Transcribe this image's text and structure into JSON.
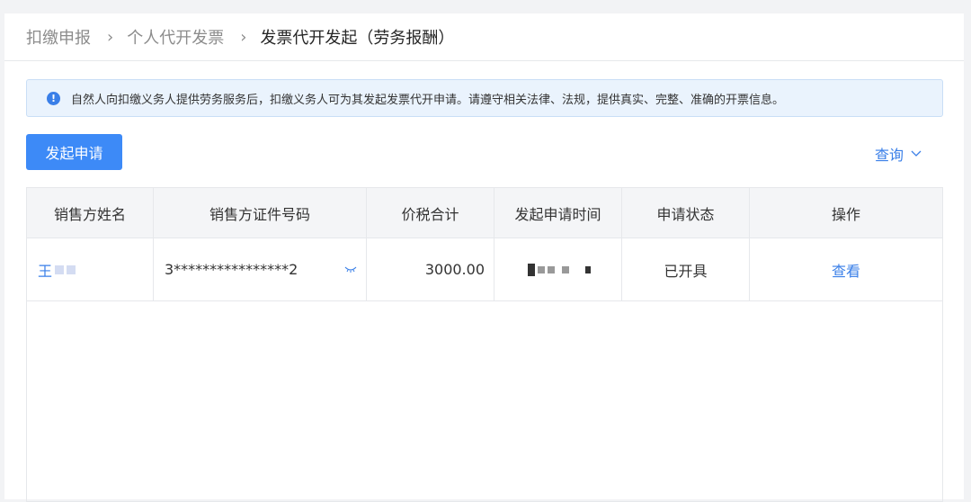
{
  "breadcrumb": {
    "items": [
      "扣缴申报",
      "个人代开发票",
      "发票代开发起（劳务报酬）"
    ],
    "separator": ">"
  },
  "notice": {
    "icon": "info-icon",
    "text": "自然人向扣缴义务人提供劳务服务后，扣缴义务人可为其发起发票代开申请。请遵守相关法律、法规，提供真实、完整、准确的开票信息。"
  },
  "toolbar": {
    "apply_label": "发起申请",
    "query_label": "查询"
  },
  "table": {
    "headers": [
      "销售方姓名",
      "销售方证件号码",
      "价税合计",
      "发起申请时间",
      "申请状态",
      "操作"
    ],
    "rows": [
      {
        "name": "王",
        "id_number": "3****************2",
        "amount": "3000.00",
        "status": "已开具",
        "action": "查看"
      }
    ]
  },
  "colors": {
    "primary": "#3d8af7",
    "link": "#3a7fe8",
    "notice_bg": "#eaf3fd"
  }
}
